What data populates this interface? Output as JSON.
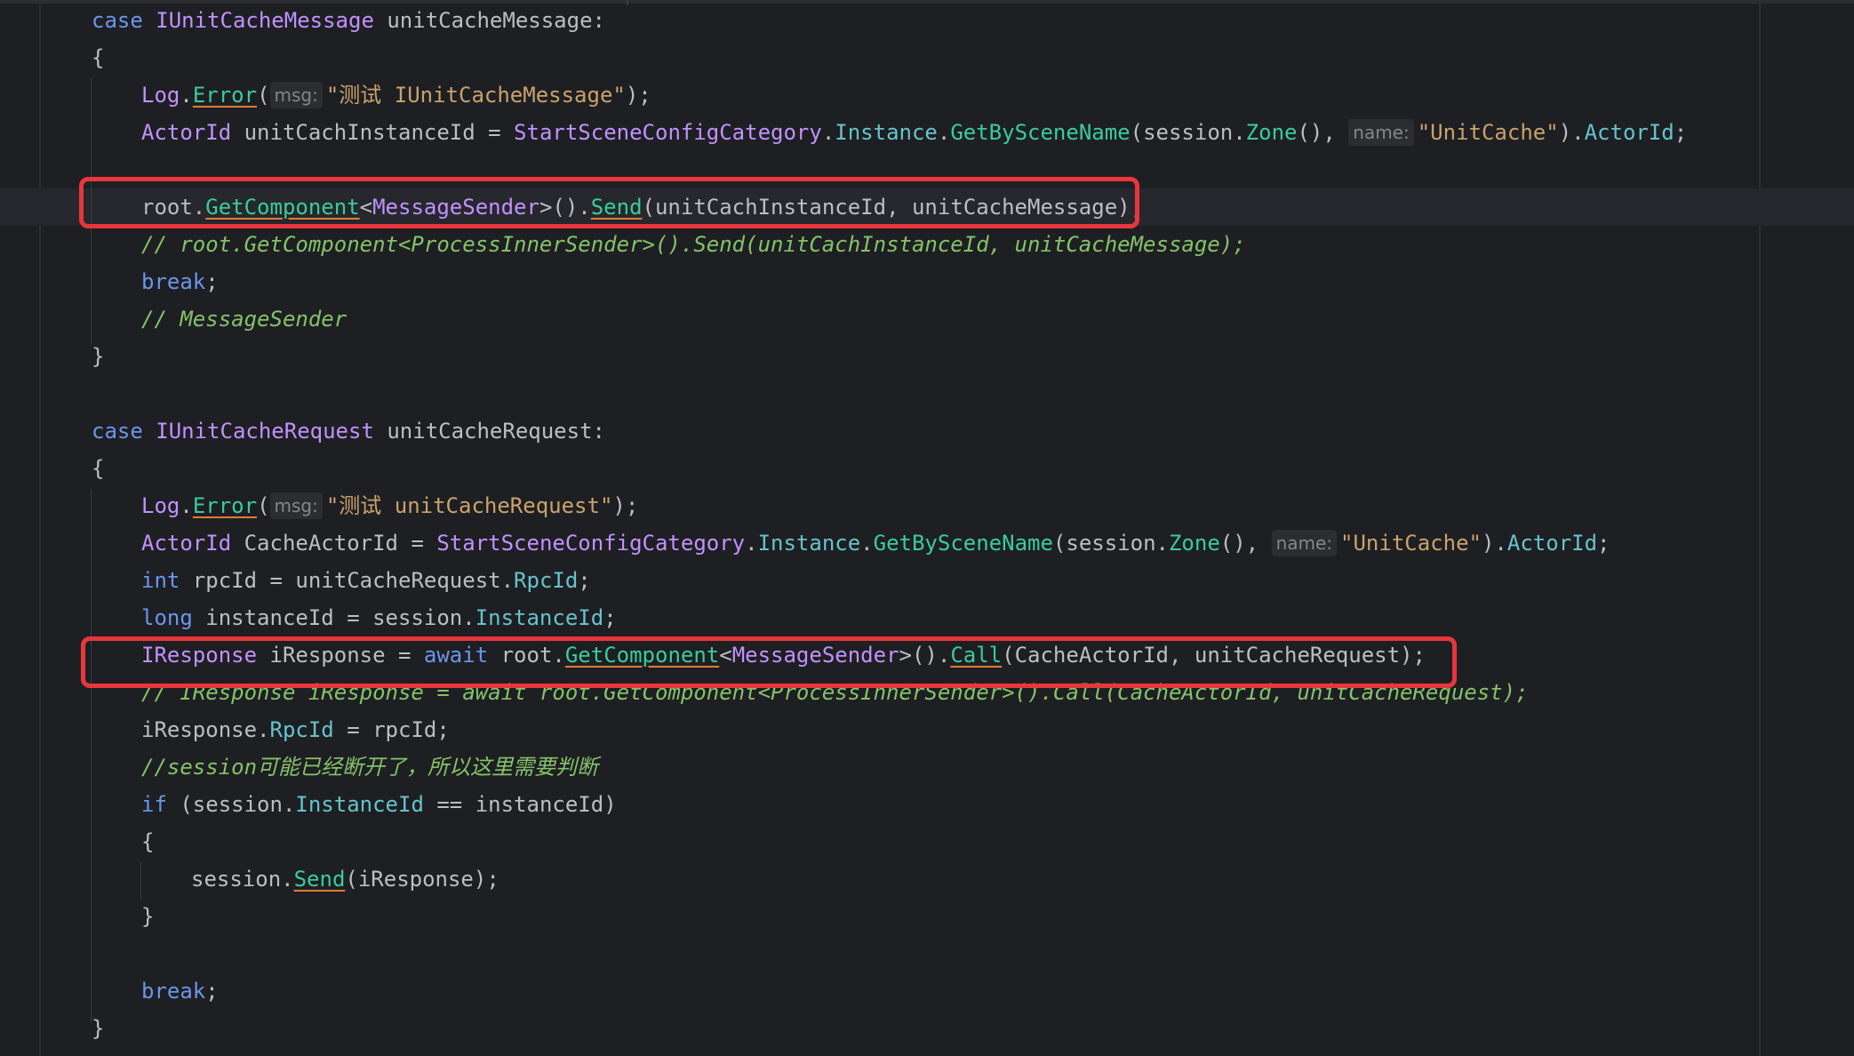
{
  "case1": {
    "case_kw": "case",
    "type": "IUnitCacheMessage",
    "rest": " unitCacheMessage:",
    "open_brace": "{",
    "close_brace": "}",
    "log": {
      "obj": "Log",
      "dot": ".",
      "method": "Error",
      "paren": "(",
      "hint": "msg:",
      "str": "\"测试 IUnitCacheMessage\"",
      "end": ");"
    },
    "actor": {
      "type": "ActorId",
      "var": " unitCachInstanceId = ",
      "cls": "StartSceneConfigCategory",
      "dot1": ".",
      "inst": "Instance",
      "dot2": ".",
      "method": "GetBySceneName",
      "args1": "(session.",
      "zone": "Zone",
      "args2": "(), ",
      "hint": "name:",
      "str": "\"UnitCache\"",
      "close": ").",
      "prop": "ActorId",
      "end": ";"
    },
    "send": {
      "root": "root.",
      "gc": "GetComponent",
      "lt": "<",
      "sender": "MessageSender",
      "gt": ">().",
      "method": "Send",
      "args": "(unitCachInstanceId, unitCacheMessage);"
    },
    "comment1": "// root.GetComponent<ProcessInnerSender>().Send(unitCachInstanceId, unitCacheMessage);",
    "break_kw": "break",
    "break_end": ";",
    "comment2": "// MessageSender"
  },
  "case2": {
    "case_kw": "case",
    "type": "IUnitCacheRequest",
    "rest": " unitCacheRequest:",
    "open_brace": "{",
    "close_brace": "}",
    "log": {
      "obj": "Log",
      "dot": ".",
      "method": "Error",
      "paren": "(",
      "hint": "msg:",
      "str": "\"测试 unitCacheRequest\"",
      "end": ");"
    },
    "actor": {
      "type": "ActorId",
      "var": " CacheActorId = ",
      "cls": "StartSceneConfigCategory",
      "dot1": ".",
      "inst": "Instance",
      "dot2": ".",
      "method": "GetBySceneName",
      "args1": "(session.",
      "zone": "Zone",
      "args2": "(), ",
      "hint": "name:",
      "str": "\"UnitCache\"",
      "close": ").",
      "prop": "ActorId",
      "end": ";"
    },
    "rpc": {
      "kw": "int",
      "text": " rpcId = unitCacheRequest.",
      "prop": "RpcId",
      "end": ";"
    },
    "inst": {
      "kw": "long",
      "text": " instanceId = session.",
      "prop": "InstanceId",
      "end": ";"
    },
    "call": {
      "type": "IResponse",
      "text": " iResponse = ",
      "await": "await",
      "root": " root.",
      "gc": "GetComponent",
      "lt": "<",
      "sender": "MessageSender",
      "gt": ">().",
      "method": "Call",
      "args": "(CacheActorId, unitCacheRequest);"
    },
    "comment1": "// IResponse iResponse = await root.GetComponent<ProcessInnerSender>().Call(CacheActorId, unitCacheRequest);",
    "assign": {
      "text": "iResponse.",
      "prop": "RpcId",
      "end": " = rpcId;"
    },
    "comment2": "//session可能已经断开了，所以这里需要判断",
    "if": {
      "kw": "if",
      "open": " (session.",
      "prop": "InstanceId",
      "end": " == instanceId)"
    },
    "if_open": "{",
    "session_send": {
      "text": "session.",
      "method": "Send",
      "end": "(iResponse);"
    },
    "if_close": "}",
    "break_kw": "break",
    "break_end": ";"
  }
}
